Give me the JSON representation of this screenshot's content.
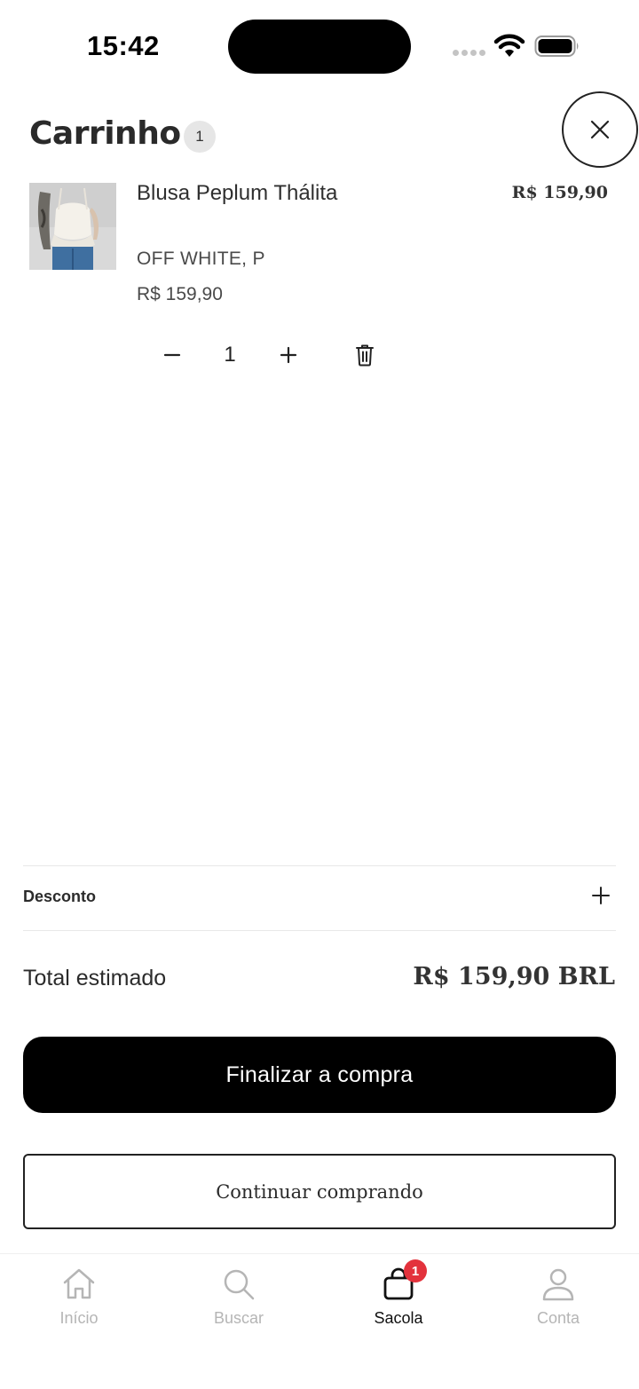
{
  "status_bar": {
    "time": "15:42"
  },
  "header": {
    "title": "Carrinho",
    "count": "1",
    "close_icon": "close-icon"
  },
  "cart_item": {
    "name": "Blusa Peplum Thálita",
    "price_right": "R$ 159,90",
    "variant": "OFF WHITE,  P",
    "price": "R$ 159,90",
    "quantity": "1"
  },
  "discount": {
    "label": "Desconto"
  },
  "total": {
    "label": "Total estimado",
    "value": "R$ 159,90 BRL"
  },
  "buttons": {
    "checkout": "Finalizar a compra",
    "continue": "Continuar comprando"
  },
  "tab_bar": {
    "items": [
      {
        "label": "Início",
        "icon": "home-icon"
      },
      {
        "label": "Buscar",
        "icon": "search-icon"
      },
      {
        "label": "Sacola",
        "icon": "bag-icon",
        "badge": "1"
      },
      {
        "label": "Conta",
        "icon": "user-icon"
      }
    ],
    "active_color": "#111111",
    "inactive_color": "#b5b5b5",
    "badge_color": "#e3323c"
  }
}
